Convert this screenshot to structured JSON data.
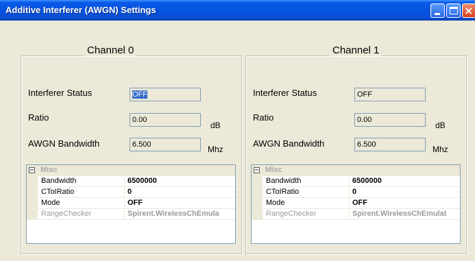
{
  "window": {
    "title": "Additive Interferer (AWGN) Settings",
    "close_glyph": "×"
  },
  "channels": [
    {
      "title": "Channel 0",
      "fields": {
        "interferer_status": {
          "label": "Interferer Status",
          "value": "OFF"
        },
        "ratio": {
          "label": "Ratio",
          "value": "0.00",
          "unit": "dB"
        },
        "awgn_bandwidth": {
          "label": "AWGN Bandwidth",
          "value": "6.500",
          "unit": "Mhz"
        }
      },
      "grid": {
        "category": "Misc",
        "toggle": "−",
        "rows": [
          {
            "name": "Bandwidth",
            "value": "6500000"
          },
          {
            "name": "CToIRatio",
            "value": "0"
          },
          {
            "name": "Mode",
            "value": "OFF"
          },
          {
            "name": "RangeChecker",
            "value": "Spirent.WirelessChEmula"
          }
        ]
      }
    },
    {
      "title": "Channel 1",
      "fields": {
        "interferer_status": {
          "label": "Interferer Status",
          "value": "OFF"
        },
        "ratio": {
          "label": "Ratio",
          "value": "0.00",
          "unit": "dB"
        },
        "awgn_bandwidth": {
          "label": "AWGN Bandwidth",
          "value": "6.500",
          "unit": "Mhz"
        }
      },
      "grid": {
        "category": "Misc",
        "toggle": "−",
        "rows": [
          {
            "name": "Bandwidth",
            "value": "6500000"
          },
          {
            "name": "CToIRatio",
            "value": "0"
          },
          {
            "name": "Mode",
            "value": "OFF"
          },
          {
            "name": "RangeChecker",
            "value": "Spirent.WirelessChEmulat"
          }
        ]
      }
    }
  ],
  "colors": {
    "titlebar": "#0553e0",
    "window_bg": "#ece9d8",
    "selection": "#316ac5"
  }
}
